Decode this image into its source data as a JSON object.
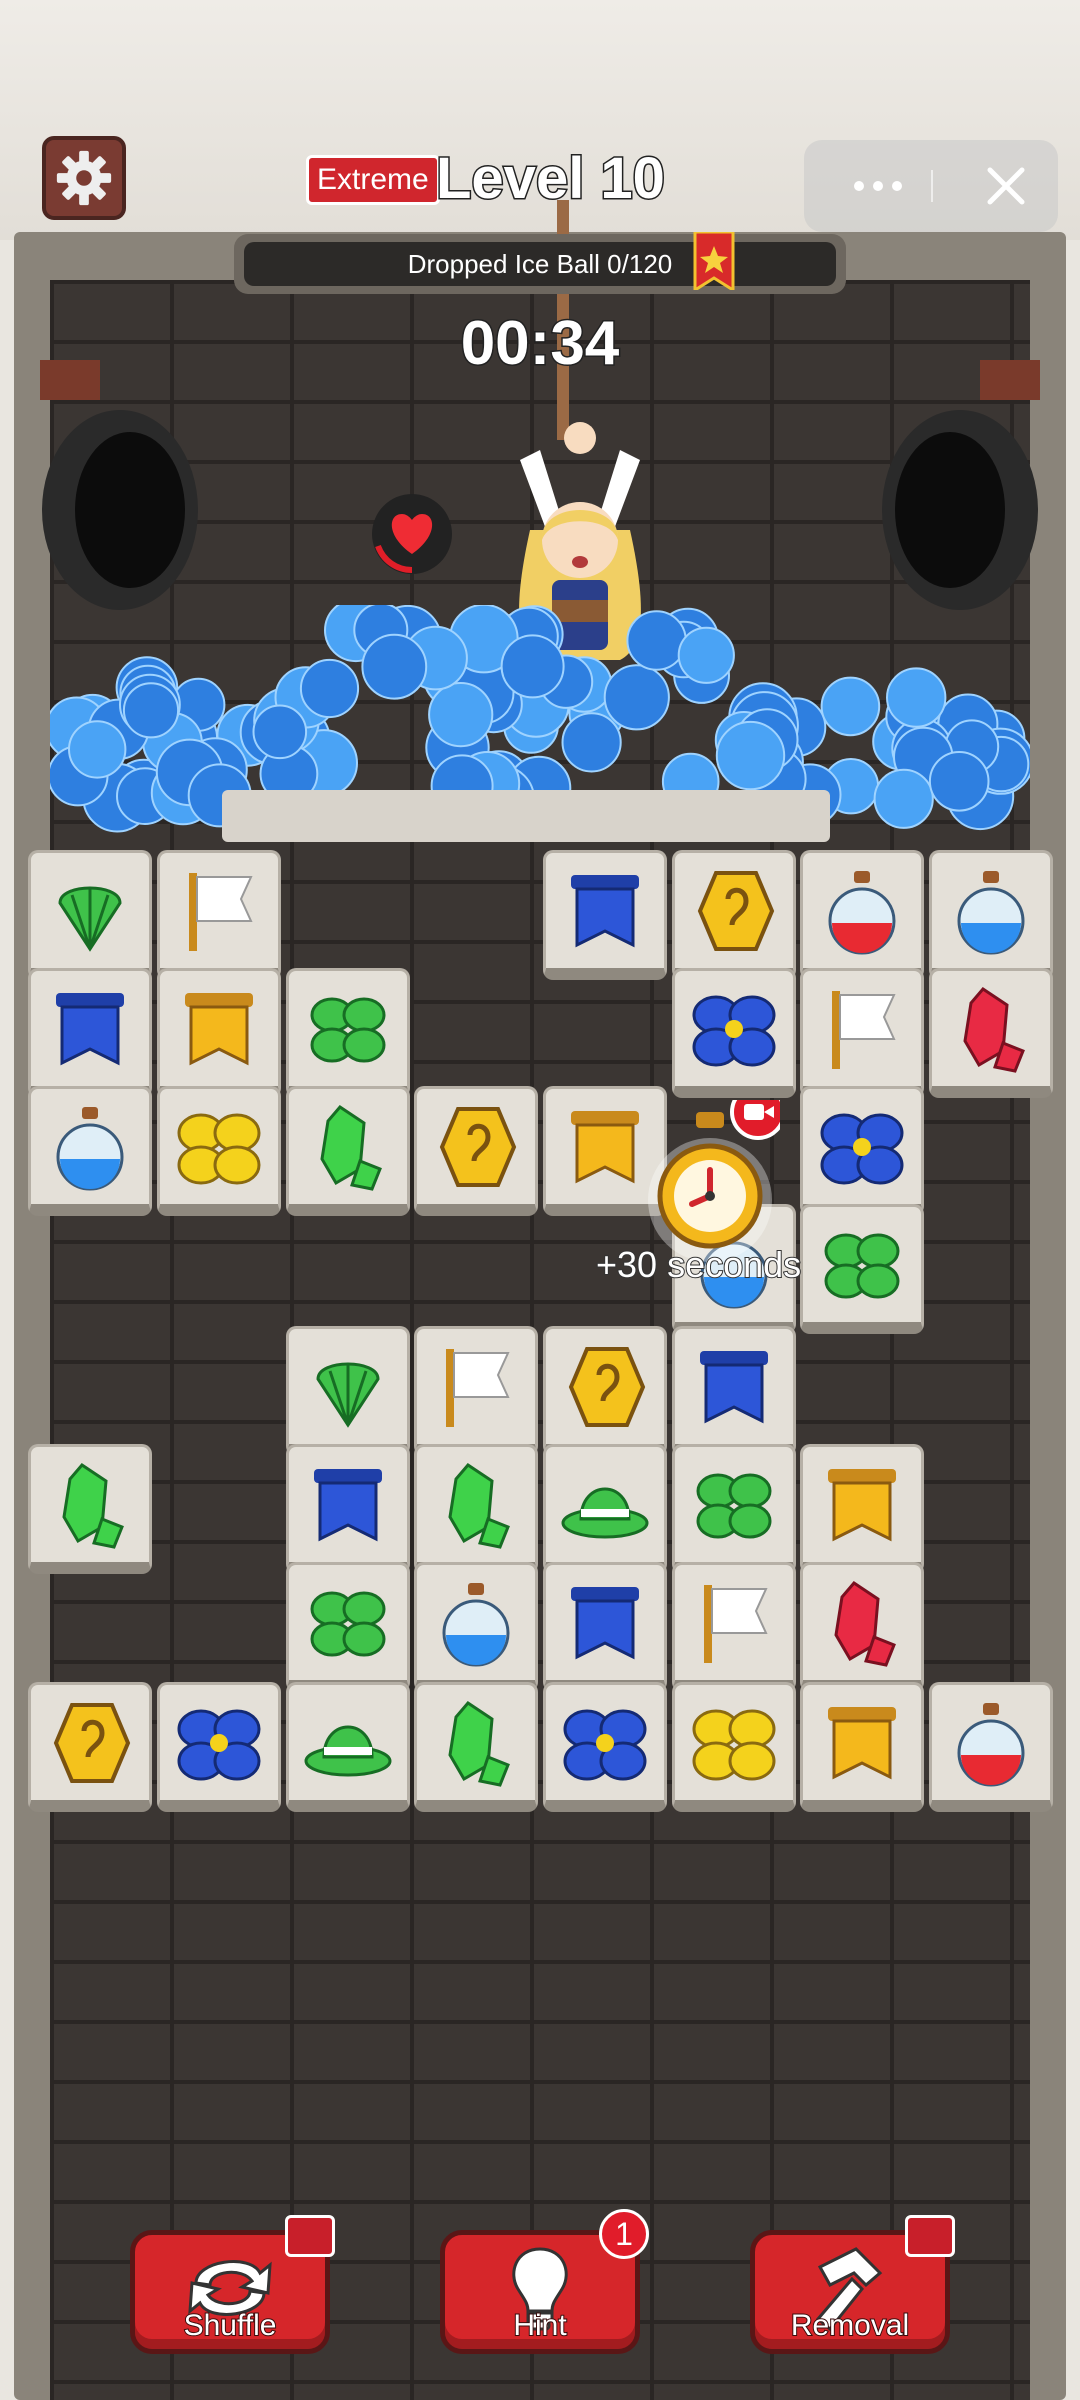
{
  "header": {
    "difficulty": "Extreme",
    "level_title": "Level 10",
    "goal_text": "Dropped Ice Ball 0/120",
    "timer": "00:34"
  },
  "bonus": {
    "label": "+30 seconds"
  },
  "powerups": {
    "shuffle": {
      "label": "Shuffle",
      "icon": "shuffle-arrows-icon"
    },
    "hint": {
      "label": "Hint",
      "icon": "lightbulb-icon",
      "count": "1"
    },
    "removal": {
      "label": "Removal",
      "icon": "hammer-icon"
    }
  },
  "colors": {
    "accent_red": "#d6262a",
    "ice_blue": "#2e7fe0",
    "wall": "#3b3633"
  },
  "board": {
    "tiles": [
      {
        "icon": "shell",
        "col": 0,
        "row": 0
      },
      {
        "icon": "flag",
        "col": 1,
        "row": 0
      },
      {
        "icon": "blue-banner",
        "col": 4,
        "row": 0
      },
      {
        "icon": "coin",
        "col": 5,
        "row": 0
      },
      {
        "icon": "red-potion",
        "col": 6,
        "row": 0
      },
      {
        "icon": "blue-potion",
        "col": 7,
        "row": 0
      },
      {
        "icon": "blue-banner",
        "col": 0,
        "row": 1
      },
      {
        "icon": "gold-banner",
        "col": 1,
        "row": 1
      },
      {
        "icon": "green-leaf",
        "col": 2,
        "row": 1
      },
      {
        "icon": "blue-flower",
        "col": 5,
        "row": 1
      },
      {
        "icon": "flag",
        "col": 6,
        "row": 1
      },
      {
        "icon": "red-gem",
        "col": 7,
        "row": 1
      },
      {
        "icon": "blue-potion",
        "col": 0,
        "row": 2
      },
      {
        "icon": "yellow-flower",
        "col": 1,
        "row": 2
      },
      {
        "icon": "green-gem",
        "col": 2,
        "row": 2
      },
      {
        "icon": "coin",
        "col": 3,
        "row": 2
      },
      {
        "icon": "gold-banner",
        "col": 4,
        "row": 2
      },
      {
        "icon": "blue-flower",
        "col": 6,
        "row": 2
      },
      {
        "icon": "blue-potion",
        "col": 5,
        "row": 3
      },
      {
        "icon": "green-leaf",
        "col": 6,
        "row": 3
      },
      {
        "icon": "shell",
        "col": 2,
        "row": 4
      },
      {
        "icon": "flag",
        "col": 3,
        "row": 4
      },
      {
        "icon": "coin",
        "col": 4,
        "row": 4
      },
      {
        "icon": "blue-banner",
        "col": 5,
        "row": 4
      },
      {
        "icon": "green-gem",
        "col": 0,
        "row": 5
      },
      {
        "icon": "blue-banner",
        "col": 2,
        "row": 5
      },
      {
        "icon": "green-gem",
        "col": 3,
        "row": 5
      },
      {
        "icon": "green-hat",
        "col": 4,
        "row": 5
      },
      {
        "icon": "green-leaf",
        "col": 5,
        "row": 5
      },
      {
        "icon": "gold-banner",
        "col": 6,
        "row": 5
      },
      {
        "icon": "green-leaf",
        "col": 2,
        "row": 6
      },
      {
        "icon": "blue-potion",
        "col": 3,
        "row": 6
      },
      {
        "icon": "blue-banner",
        "col": 4,
        "row": 6
      },
      {
        "icon": "flag",
        "col": 5,
        "row": 6
      },
      {
        "icon": "red-gem",
        "col": 6,
        "row": 6
      },
      {
        "icon": "coin",
        "col": 0,
        "row": 7
      },
      {
        "icon": "blue-flower",
        "col": 1,
        "row": 7
      },
      {
        "icon": "green-hat",
        "col": 2,
        "row": 7
      },
      {
        "icon": "green-gem",
        "col": 3,
        "row": 7
      },
      {
        "icon": "blue-flower",
        "col": 4,
        "row": 7
      },
      {
        "icon": "yellow-flower",
        "col": 5,
        "row": 7
      },
      {
        "icon": "gold-banner",
        "col": 6,
        "row": 7
      },
      {
        "icon": "red-potion",
        "col": 7,
        "row": 7
      }
    ]
  }
}
